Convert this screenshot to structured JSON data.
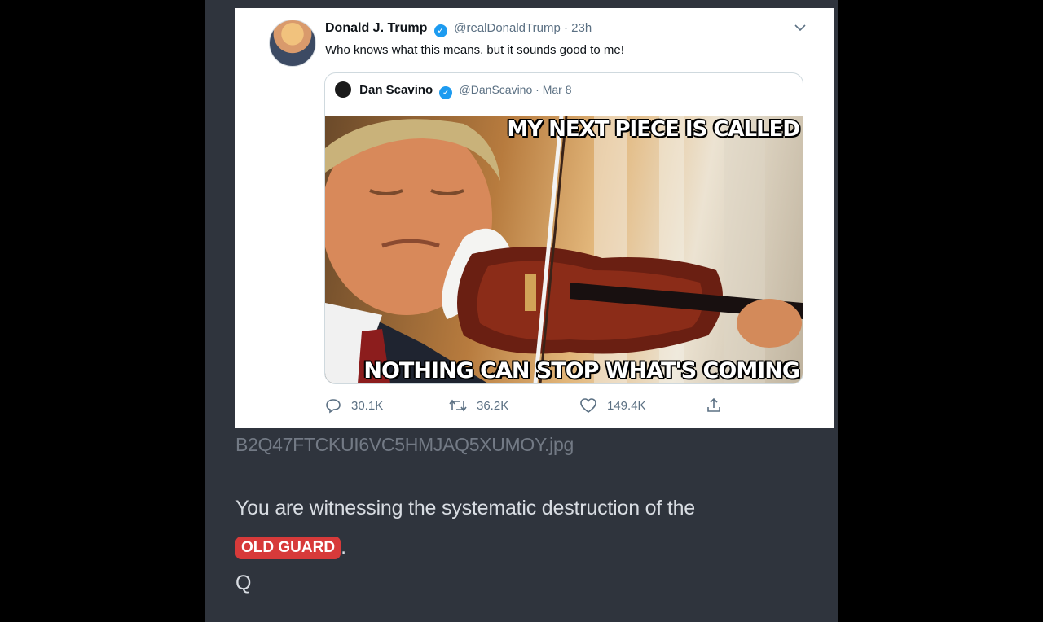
{
  "tweet": {
    "author_name": "Donald J. Trump",
    "author_handle": "@realDonaldTrump · 23h",
    "text": "Who knows what this means, but it sounds good to me!",
    "quoted": {
      "author_name": "Dan Scavino",
      "author_handle": "@DanScavino · Mar 8",
      "meme_top_text": "MY NEXT PIECE IS CALLED",
      "meme_bottom_text": "NOTHING CAN STOP WHAT'S COMING"
    },
    "counts": {
      "replies": "30.1K",
      "retweets": "36.2K",
      "likes": "149.4K"
    }
  },
  "post": {
    "filename": "B2Q47FTCKUI6VC5HMJAQ5XUMOY.jpg",
    "line1": "You are witnessing the systematic destruction of the",
    "badge": "OLD GUARD",
    "badge_suffix": ".",
    "signature": "Q"
  },
  "colors": {
    "panel_bg": "#2f343d",
    "badge_bg": "#d73a3a",
    "verified_blue": "#1d9bf0"
  }
}
